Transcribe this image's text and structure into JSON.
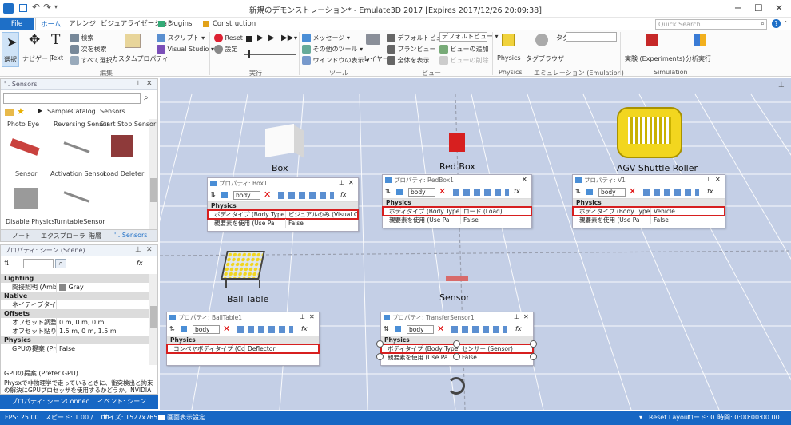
{
  "window": {
    "title": "新規のデモンストレーション* - Emulate3D 2017 [Expires 2017/12/26 20:09:38]"
  },
  "tabs": [
    "File",
    "ホーム",
    "アレンジ",
    "ビジュアライゼーション",
    "Plugins",
    "Construction"
  ],
  "search_placeholder": "Quick Search",
  "ribbon": {
    "select": "選択",
    "navigate": "ナビゲート",
    "text": "Text",
    "search": "検索",
    "search_next": "次を検索",
    "select_all": "すべて選択",
    "custom_property": "カスタムプロパティ",
    "script": "スクリプト",
    "visual_studio": "Visual Studio",
    "reset": "Reset",
    "settings": "設定",
    "message": "メッセージ",
    "other_tools": "その他のツール",
    "show_window": "ウインドウの表示",
    "layer": "レイヤー",
    "default_view": "デフォルトビュー",
    "default_view_select": "デフォルトビュー",
    "plan_view": "プランビュー",
    "add_view": "ビューの追加",
    "show_all": "全体を表示",
    "delete_view": "ビューの削除",
    "physics": "Physics",
    "tag_browser": "タグブラウザ",
    "tag": "タグ",
    "experiments": "実験 (Experiments)",
    "analysis": "分析実行",
    "groups": {
      "edit": "編集",
      "run": "実行",
      "tools": "ツール",
      "view": "ビュー",
      "physics": "Physics",
      "emulation": "エミュレーション (Emulation)",
      "simulation": "Simulation"
    }
  },
  "sensors_panel": {
    "title": "' . Sensors",
    "breadcrumb": [
      "SampleCatalog",
      "Sensors"
    ],
    "items_top": [
      "Photo Eye",
      "Reversing Sensor",
      "Start Stop Sensor"
    ],
    "items_mid": [
      "Sensor",
      "Activation Sensor",
      "Load Deleter"
    ],
    "items_bot": [
      "Disable Physics",
      "TurntableSensor"
    ],
    "tabs": [
      "ノート",
      "エクスプローラ",
      "階層",
      "' . Sensors"
    ]
  },
  "scene_panel": {
    "title": "プロパティ: シーン (Scene)",
    "rows": [
      {
        "type": "sec",
        "k": "Lighting"
      },
      {
        "type": "row",
        "k": "間接照明 (Ambient Lic",
        "v": "Gray"
      },
      {
        "type": "sec",
        "k": "Native"
      },
      {
        "type": "row",
        "k": "ネイティブタイプ名 (Nati",
        "v": ""
      },
      {
        "type": "sec",
        "k": "Offsets"
      },
      {
        "type": "row",
        "k": "オフセット調整 (Align O",
        "v": "0 m, 0 m, 0 m"
      },
      {
        "type": "row",
        "k": "オフセット貼り付け (Paste",
        "v": "1.5 m, 0 m, 1.5 m"
      },
      {
        "type": "sec",
        "k": "Physics"
      },
      {
        "type": "row",
        "k": "GPUの提案 (Prefer GP",
        "v": "False"
      }
    ],
    "desc_title": "GPUの提案 (Prefer GPU)",
    "desc_text": "Physxで非物理学で走っているときに、衝突検出と拘束の解決にGPUプロセッサを使用するかどうか。NVIDIAコン...",
    "tabs": [
      "プロパティ: シーン",
      "Connec",
      "イベント: シーン"
    ]
  },
  "viewport_labels": {
    "box": "Box",
    "redbox": "Red Box",
    "agv": "AGV Shuttle Roller",
    "balltable": "Ball Table",
    "sensor": "Sensor"
  },
  "prop_panels": {
    "box1": {
      "title": "プロパティ: Box1",
      "filter": "body",
      "section": "Physics",
      "k1": "ボディタイプ (Body Type)",
      "v1": "ビジュアルのみ (Visual Only)",
      "k2": "親要素を使用 (Use Pa",
      "v2": "False"
    },
    "redbox1": {
      "title": "プロパティ: RedBox1",
      "filter": "body",
      "section": "Physics",
      "k1": "ボディタイプ (Body Type)",
      "v1": "ロード (Load)",
      "k2": "親要素を使用 (Use Pa",
      "v2": "False"
    },
    "v1": {
      "title": "プロパティ: V1",
      "filter": "body",
      "section": "Physics",
      "k1": "ボディタイプ (Body Type)",
      "v1": "Vehicle",
      "k2": "親要素を使用 (Use Pa",
      "v2": "False"
    },
    "balltable1": {
      "title": "プロパティ: BallTable1",
      "filter": "body",
      "section": "Physics",
      "k1": "コンベヤボディタイプ (Con",
      "v1": "Deflector"
    },
    "transfersensor1": {
      "title": "プロパティ: TransferSensor1",
      "filter": "body",
      "section": "Physics",
      "k1": "ボディタイプ (Body Type)",
      "v1": "センサー (Sensor)",
      "k2": "親要素を使用 (Use Pa",
      "v2": "False"
    }
  },
  "status": {
    "fps": "FPS: 25.00",
    "speed": "スピード: 1.00 / 1.00",
    "size": "サイズ: 1527x765",
    "display": "画面表示設定",
    "reset_layout": "Reset Layout",
    "load": "ロード: 0",
    "time": "時間: 0:00:00:00.00"
  }
}
